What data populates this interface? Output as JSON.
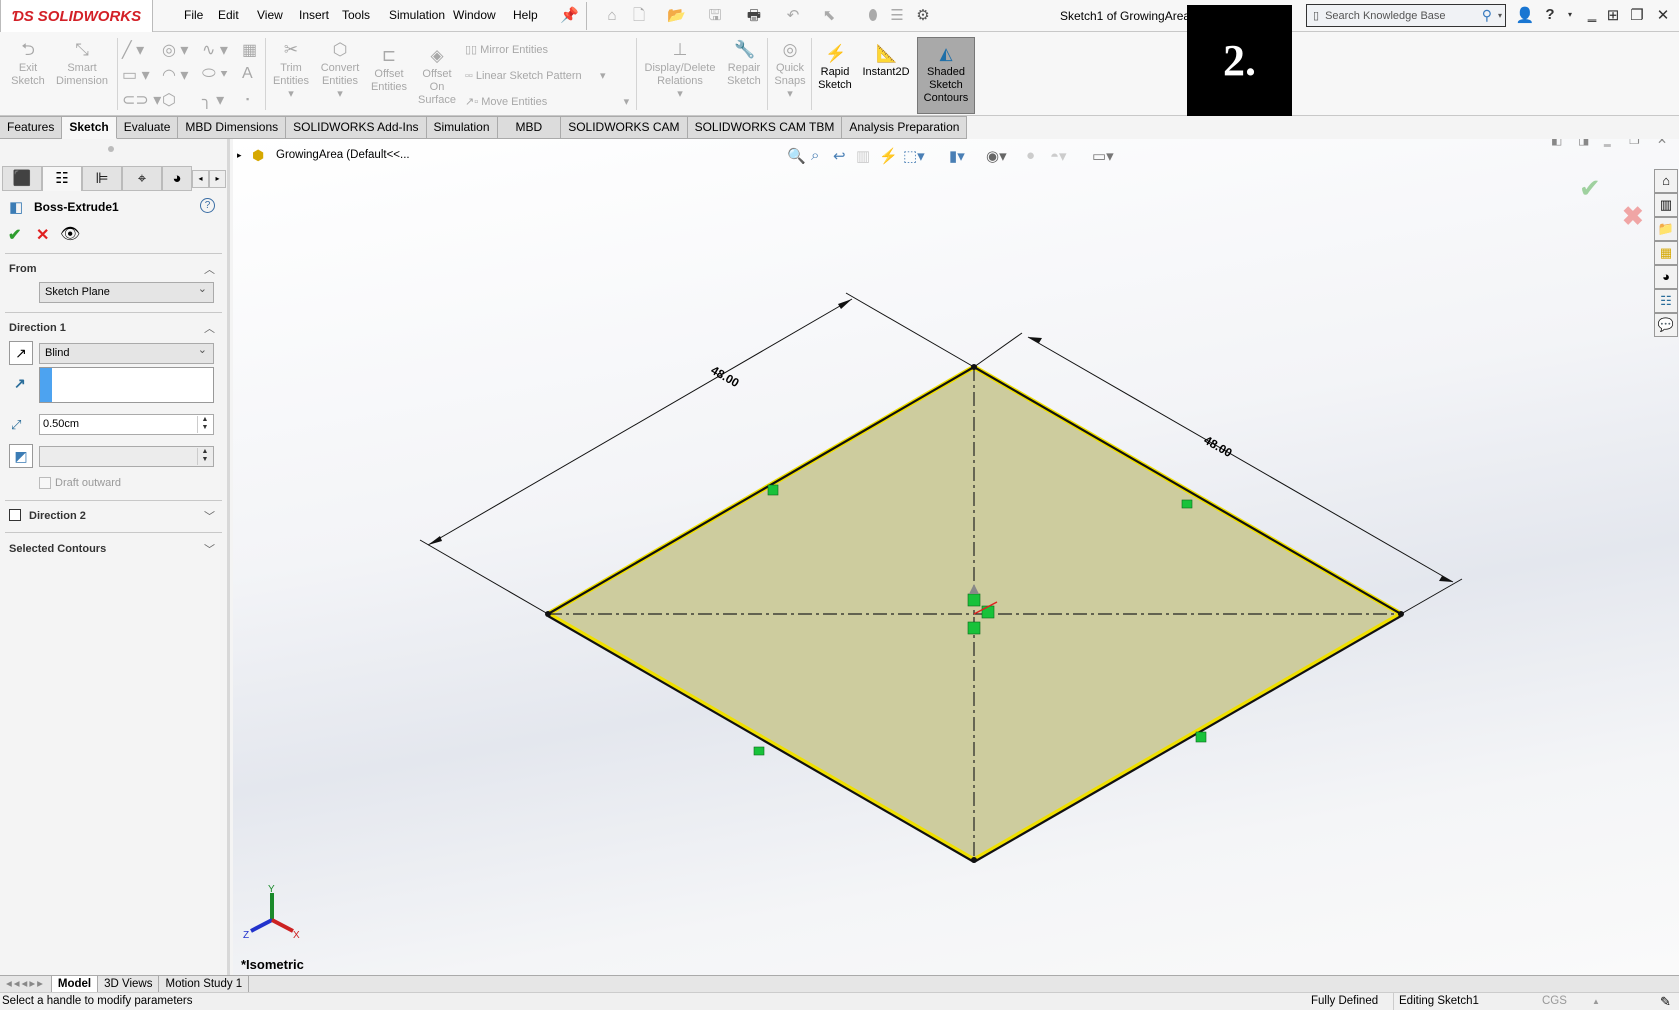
{
  "app": {
    "name": "SOLIDWORKS",
    "document_title": "Sketch1 of GrowingArea",
    "step_badge": "2."
  },
  "menu": [
    "File",
    "Edit",
    "View",
    "Insert",
    "Tools",
    "Simulation",
    "Window",
    "Help"
  ],
  "search": {
    "placeholder": "Search Knowledge Base"
  },
  "ribbon": {
    "exit_sketch": "Exit Sketch",
    "smart_dimension": "Smart Dimension",
    "trim_entities": "Trim Entities",
    "convert_entities": "Convert Entities",
    "offset_entities": "Offset Entities",
    "offset_on_surface": "Offset On Surface",
    "mirror_entities": "Mirror Entities",
    "linear_sketch_pattern": "Linear Sketch Pattern",
    "move_entities": "Move Entities",
    "display_delete_relations": "Display/Delete Relations",
    "repair_sketch": "Repair Sketch",
    "quick_snaps": "Quick Snaps",
    "rapid_sketch": "Rapid Sketch",
    "instant2d": "Instant2D",
    "shaded_sketch_contours": "Shaded Sketch Contours"
  },
  "tabs": [
    {
      "label": "Features"
    },
    {
      "label": "Sketch",
      "active": true
    },
    {
      "label": "Evaluate"
    },
    {
      "label": "MBD Dimensions"
    },
    {
      "label": "SOLIDWORKS Add-Ins"
    },
    {
      "label": "Simulation"
    },
    {
      "label": "MBD"
    },
    {
      "label": "SOLIDWORKS CAM"
    },
    {
      "label": "SOLIDWORKS CAM TBM"
    },
    {
      "label": "Analysis Preparation"
    }
  ],
  "property_manager": {
    "title": "Boss-Extrude1",
    "from": {
      "header": "From",
      "value": "Sketch Plane"
    },
    "direction1": {
      "header": "Direction 1",
      "end_condition": "Blind",
      "depth": "0.50cm",
      "draft_label": "Draft outward",
      "draft_checked": false
    },
    "direction2": {
      "header": "Direction 2",
      "checked": false
    },
    "selected_contours": {
      "header": "Selected Contours"
    }
  },
  "tree": {
    "root": "GrowingArea  (Default<<..."
  },
  "viewport": {
    "view_name": "*Isometric",
    "dimensions": [
      "48.00",
      "48.00"
    ],
    "sketch_fill": "#cdcc9e",
    "edge_highlight": "#f0e000"
  },
  "triad": {
    "x": "X",
    "y": "Y",
    "z": "Z"
  },
  "model_tabs": [
    {
      "label": "Model",
      "active": true
    },
    {
      "label": "3D Views"
    },
    {
      "label": "Motion Study 1"
    }
  ],
  "status": {
    "message": "Select a handle to modify parameters",
    "sketch_state": "Fully Defined",
    "mode": "Editing Sketch1",
    "units": "CGS"
  }
}
